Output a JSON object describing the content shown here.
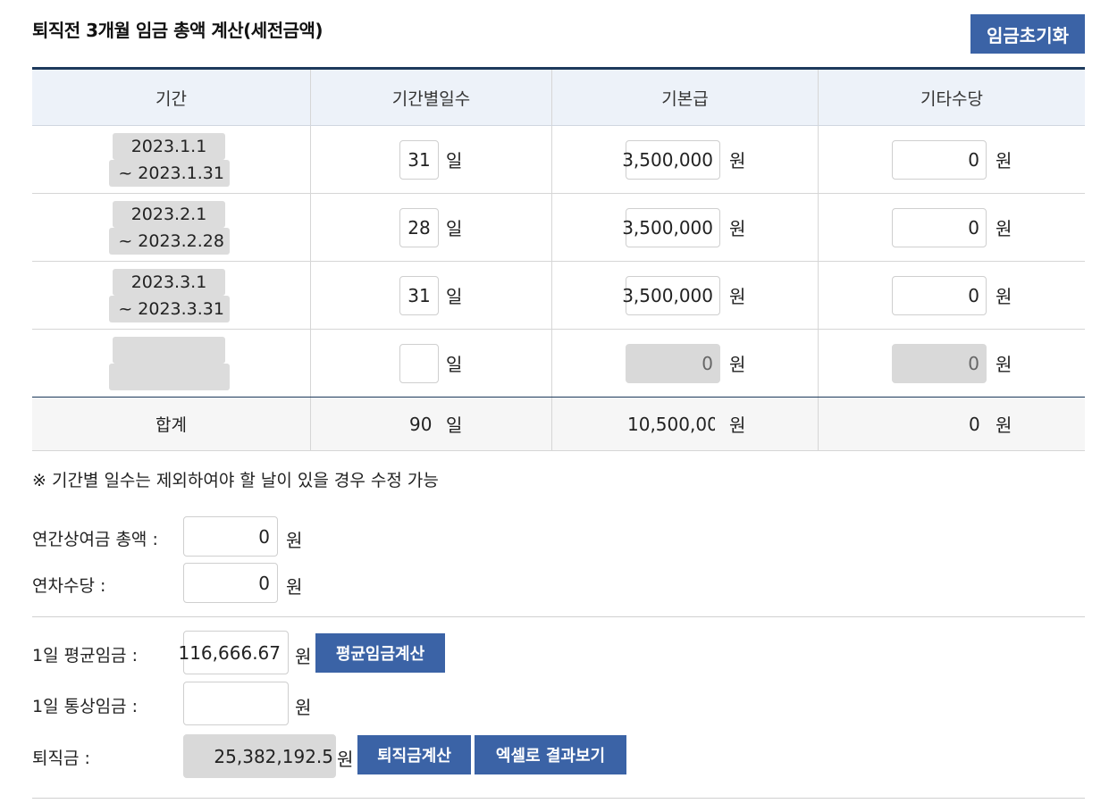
{
  "header": {
    "title": "퇴직전 3개월 임금 총액 계산(세전금액)",
    "reset_label": "임금초기화"
  },
  "table": {
    "columns": [
      "기간",
      "기간별일수",
      "기본급",
      "기타수당"
    ],
    "rows": [
      {
        "period_start": "2023.1.1",
        "period_end": "~ 2023.1.31",
        "days": "31",
        "day_unit": "일",
        "base_pay": "3,500,000",
        "other_pay": "0",
        "won": "원"
      },
      {
        "period_start": "2023.2.1",
        "period_end": "~ 2023.2.28",
        "days": "28",
        "day_unit": "일",
        "base_pay": "3,500,000",
        "other_pay": "0",
        "won": "원"
      },
      {
        "period_start": "2023.3.1",
        "period_end": "~ 2023.3.31",
        "days": "31",
        "day_unit": "일",
        "base_pay": "3,500,000",
        "other_pay": "0",
        "won": "원"
      },
      {
        "period_start": "",
        "period_end": "",
        "days": "",
        "day_unit": "일",
        "base_pay": "0",
        "other_pay": "0",
        "won": "원"
      }
    ],
    "total": {
      "label": "합계",
      "days": "90",
      "day_unit": "일",
      "base_pay": "10,500,00",
      "other_pay": "0",
      "won": "원"
    }
  },
  "note": "※ 기간별 일수는 제외하여야 할 날이 있을 경우 수정 가능",
  "bonus": {
    "label": "연간상여금 총액 :",
    "value": "0",
    "unit": "원"
  },
  "annual_leave": {
    "label": "연차수당 :",
    "value": "0",
    "unit": "원"
  },
  "avg_wage": {
    "label": "1일 평균임금 :",
    "value": "116,666.67",
    "unit": "원",
    "button": "평균임금계산"
  },
  "ordinary_wage": {
    "label": "1일 통상임금 :",
    "value": "",
    "unit": "원"
  },
  "severance": {
    "label": "퇴직금 :",
    "value": "25,382,192.5",
    "unit": "원",
    "calc_button": "퇴직금계산",
    "excel_button": "엑셀로 결과보기"
  },
  "colors": {
    "accent": "#3b63a6",
    "header_bg": "#edf2f9",
    "border_dark": "#1d3a5c",
    "disabled": "#d9d9d9"
  }
}
